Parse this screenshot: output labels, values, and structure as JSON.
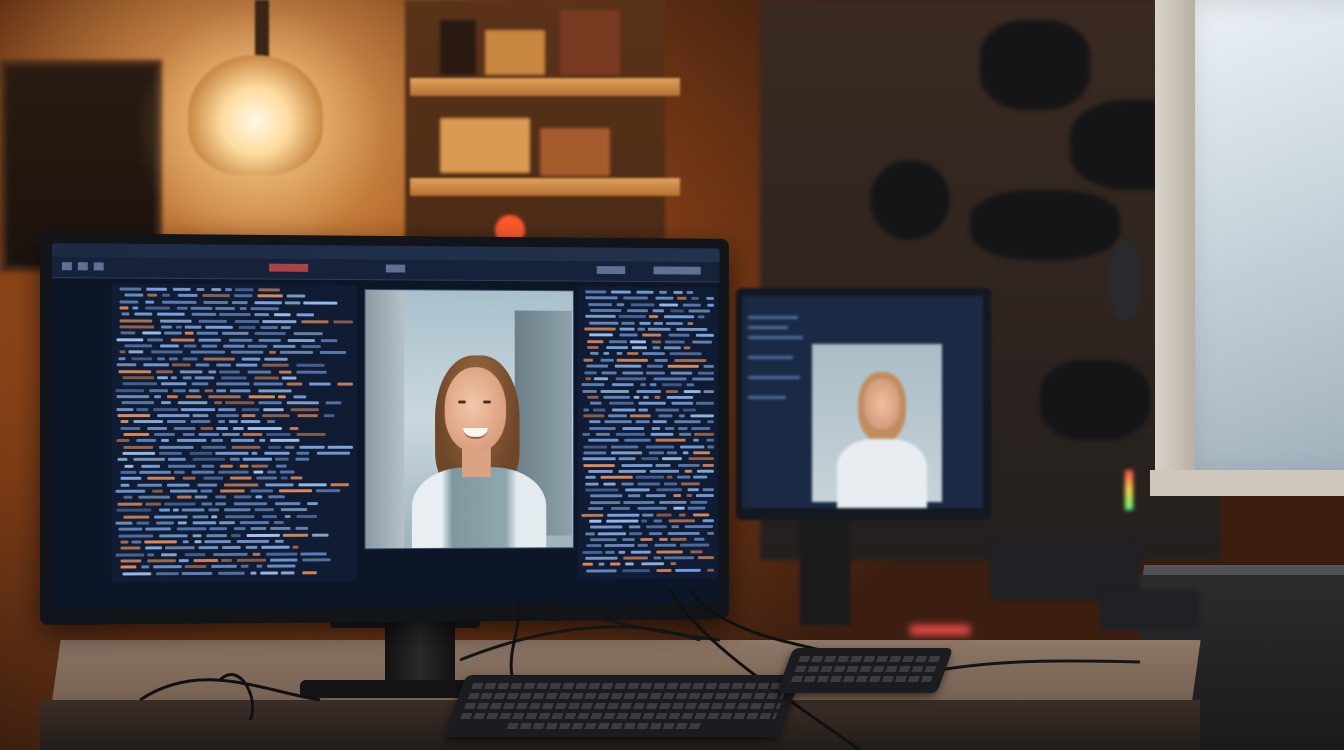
{
  "scene": {
    "description_colors": {
      "wall_warm": "#b8611f",
      "screen_bg": "#0d1626",
      "code_blue": "#7ea7e6",
      "code_orange": "#e08a5a",
      "lamp_glow": "#ffdca0"
    }
  },
  "icons": [
    "lamp-icon",
    "keyboard-icon",
    "monitor-icon"
  ]
}
